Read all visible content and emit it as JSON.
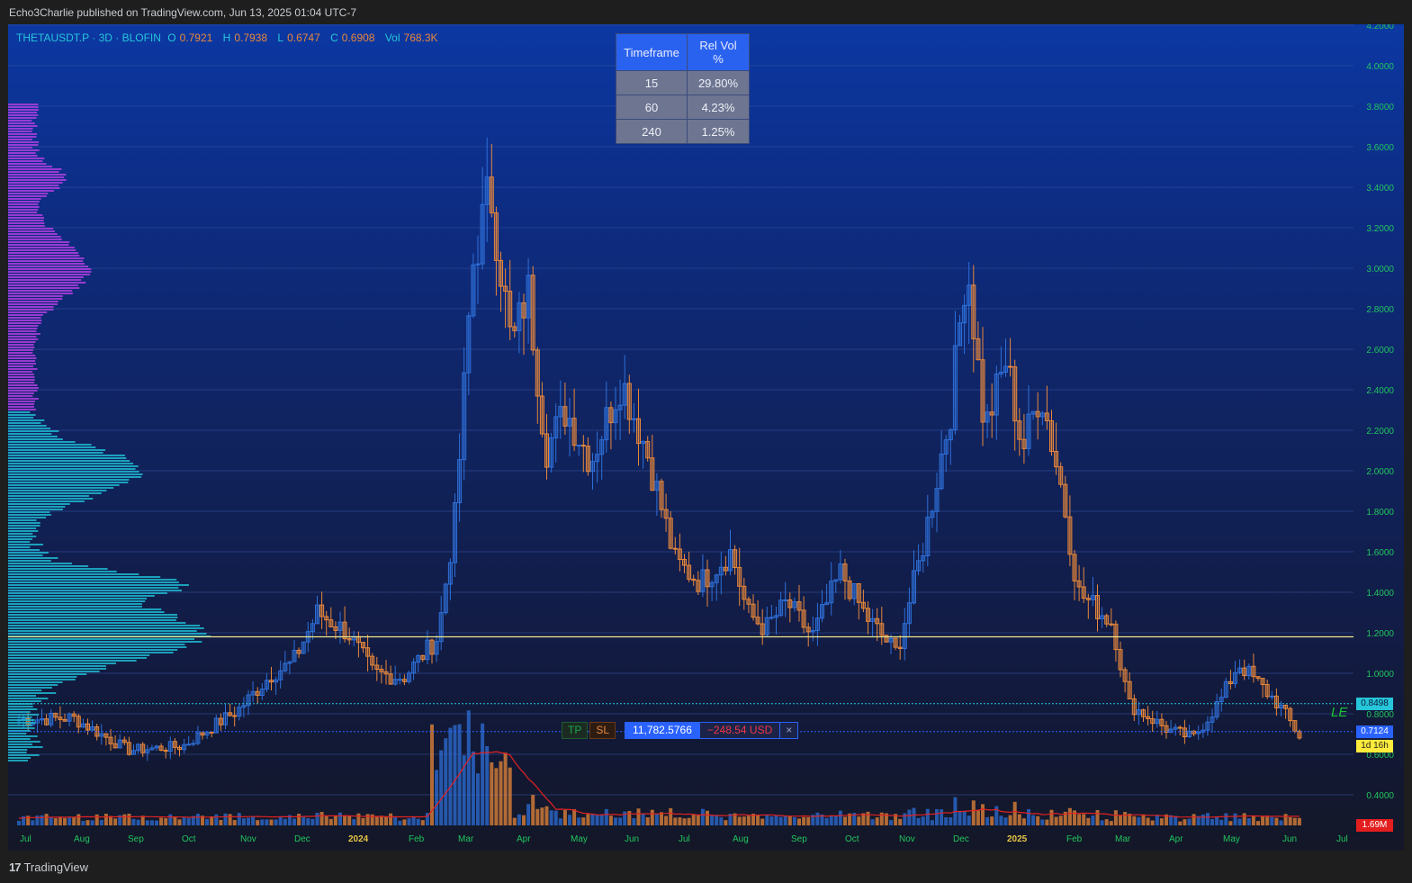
{
  "header": {
    "published_text": "Echo3Charlie published on TradingView.com, Jun 13, 2025 01:04 UTC-7"
  },
  "symbol_info": {
    "name": "THETAUSDT.P · 3D · BLOFIN",
    "open_label": "O",
    "open": "0.7921",
    "high_label": "H",
    "high": "0.7938",
    "low_label": "L",
    "low": "0.6747",
    "close_label": "C",
    "close": "0.6908",
    "vol_label": "Vol",
    "vol": "768.3K"
  },
  "relvol_table": {
    "headers": [
      "Timeframe",
      "Rel Vol %"
    ],
    "rows": [
      [
        "15",
        "29.80%"
      ],
      [
        "60",
        "4.23%"
      ],
      [
        "240",
        "1.25%"
      ]
    ]
  },
  "price_tags": {
    "level1": "0.8498",
    "current": "0.7124",
    "countdown": "1d 16h",
    "volume": "1.69M"
  },
  "strategy_label": "LE",
  "position": {
    "tp": "TP",
    "sl": "SL",
    "qty": "11,782.5766",
    "pnl": "−248.54 USD",
    "close": "×"
  },
  "footer": {
    "logo_mark": "17",
    "logo_text": "TradingView"
  },
  "colors": {
    "up": "#2e6fd8",
    "down": "#e8873a",
    "profile_upper": "#b03ee0",
    "profile_lower": "#1fb8cf",
    "grid": "#3552a0",
    "hline": "#f0e68c",
    "ma": "#e32222",
    "axis_text": "#22c55e"
  },
  "chart_data": {
    "type": "candlestick",
    "symbol": "THETAUSDT.P",
    "interval": "3D",
    "exchange": "BLOFIN",
    "y_ticks": [
      "0.4000",
      "0.6000",
      "0.8000",
      "1.0000",
      "1.2000",
      "1.4000",
      "1.6000",
      "1.8000",
      "2.0000",
      "2.2000",
      "2.4000",
      "2.6000",
      "2.8000",
      "3.0000",
      "3.2000",
      "3.4000",
      "3.6000",
      "3.8000",
      "4.0000",
      "4.2000"
    ],
    "x_ticks": [
      "Jul",
      "Aug",
      "Sep",
      "Oct",
      "Nov",
      "Dec",
      "2024",
      "Feb",
      "Mar",
      "Apr",
      "May",
      "Jun",
      "Jul",
      "Aug",
      "Sep",
      "Oct",
      "Nov",
      "Dec",
      "2025",
      "Feb",
      "Mar",
      "Apr",
      "May",
      "Jun",
      "Jul"
    ],
    "ylim": [
      0.35,
      4.2
    ],
    "horizontal_lines": [
      1.18,
      0.8498,
      0.7124
    ],
    "price_path": [
      [
        "2023-07",
        0.77
      ],
      [
        "2023-08",
        0.78
      ],
      [
        "2023-09",
        0.62
      ],
      [
        "2023-10",
        0.64
      ],
      [
        "2023-11",
        0.82
      ],
      [
        "2023-11-20",
        1.0
      ],
      [
        "2023-12",
        1.05
      ],
      [
        "2023-12-15",
        1.3
      ],
      [
        "2024-01",
        1.2
      ],
      [
        "2024-01-15",
        1.0
      ],
      [
        "2024-02",
        0.98
      ],
      [
        "2024-02-20",
        1.18
      ],
      [
        "2024-03",
        1.8
      ],
      [
        "2024-03-10",
        3.0
      ],
      [
        "2024-03-20",
        3.4
      ],
      [
        "2024-04",
        2.6
      ],
      [
        "2024-04-10",
        2.9
      ],
      [
        "2024-04-20",
        2.1
      ],
      [
        "2024-05",
        2.3
      ],
      [
        "2024-05-15",
        2.05
      ],
      [
        "2024-06",
        2.45
      ],
      [
        "2024-06-15",
        2.1
      ],
      [
        "2024-07",
        1.55
      ],
      [
        "2024-07-15",
        1.45
      ],
      [
        "2024-08",
        1.6
      ],
      [
        "2024-08-10",
        1.3
      ],
      [
        "2024-08-20",
        1.22
      ],
      [
        "2024-09",
        1.35
      ],
      [
        "2024-09-15",
        1.18
      ],
      [
        "2024-10",
        1.5
      ],
      [
        "2024-10-15",
        1.28
      ],
      [
        "2024-11",
        1.1
      ],
      [
        "2024-11-15",
        1.6
      ],
      [
        "2024-12",
        2.3
      ],
      [
        "2024-12-10",
        3.05
      ],
      [
        "2024-12-20",
        2.2
      ],
      [
        "2025-01",
        2.55
      ],
      [
        "2025-01-10",
        2.1
      ],
      [
        "2025-01-20",
        2.4
      ],
      [
        "2025-02",
        1.9
      ],
      [
        "2025-02-10",
        1.4
      ],
      [
        "2025-03",
        1.25
      ],
      [
        "2025-03-10",
        0.85
      ],
      [
        "2025-04",
        0.72
      ],
      [
        "2025-04-15",
        0.68
      ],
      [
        "2025-05",
        0.88
      ],
      [
        "2025-05-10",
        1.05
      ],
      [
        "2025-06",
        0.85
      ],
      [
        "2025-06-13",
        0.69
      ]
    ]
  }
}
